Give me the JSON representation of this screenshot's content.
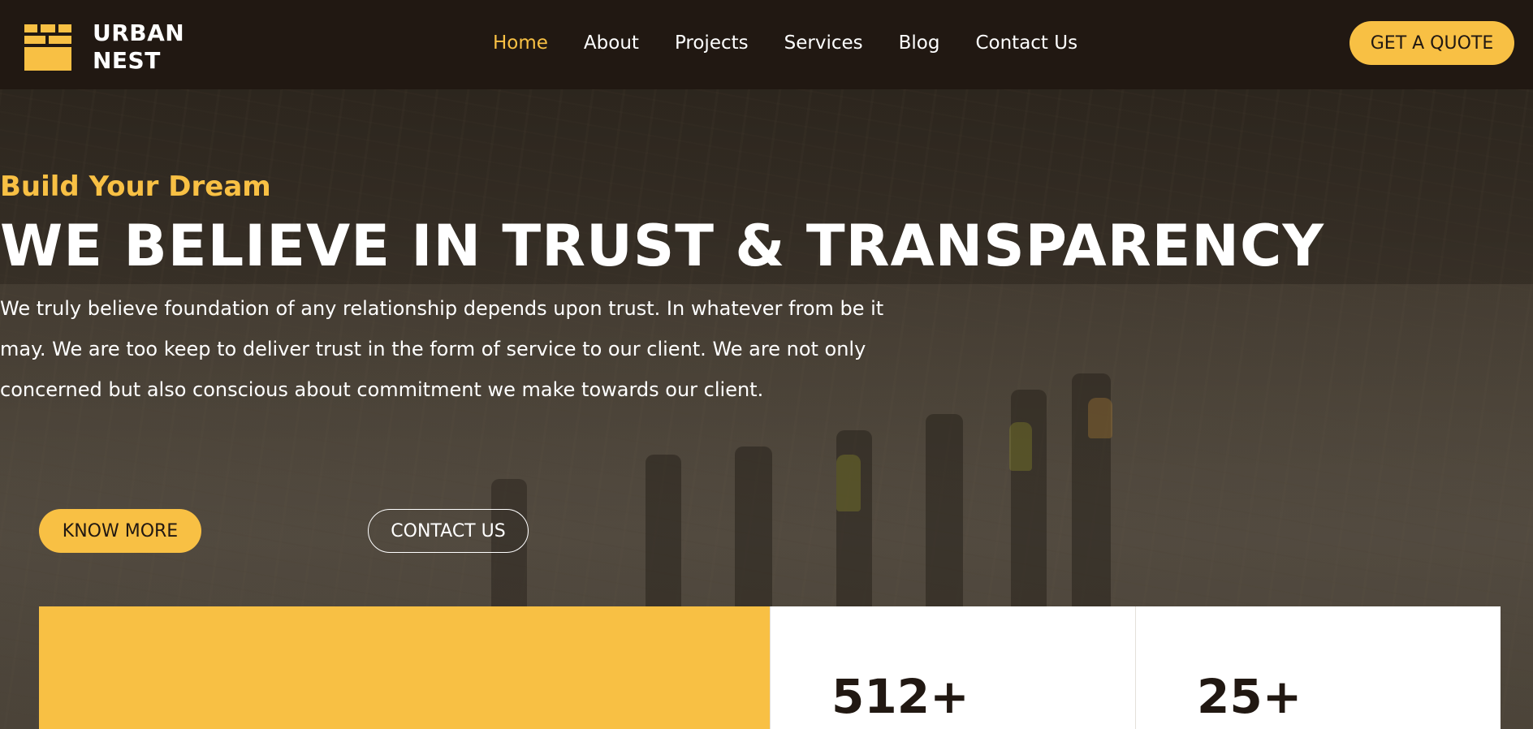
{
  "brand": {
    "name_line1": "URBAN",
    "name_line2": "NEST",
    "accent_color": "#f8c044",
    "nav_bg_color": "#211812"
  },
  "nav": {
    "items": [
      {
        "label": "Home",
        "active": true
      },
      {
        "label": "About",
        "active": false
      },
      {
        "label": "Projects",
        "active": false
      },
      {
        "label": "Services",
        "active": false
      },
      {
        "label": "Blog",
        "active": false
      },
      {
        "label": "Contact Us",
        "active": false
      }
    ],
    "cta_label": "GET A QUOTE"
  },
  "hero": {
    "subtitle": "Build Your Dream",
    "headline": "WE BELIEVE IN TRUST & TRANSPARENCY",
    "description_lines": [
      "We truly believe foundation of any relationship depends upon trust. In whatever from be it",
      "may. We are too keep to deliver trust in the form of service to our client. We are not only",
      "concerned but also conscious about commitment we make towards our client."
    ],
    "primary_button": "KNOW MORE",
    "secondary_button": "CONTACT US"
  },
  "stats": {
    "items": [
      {
        "value": "512+"
      },
      {
        "value": "25+"
      }
    ]
  }
}
